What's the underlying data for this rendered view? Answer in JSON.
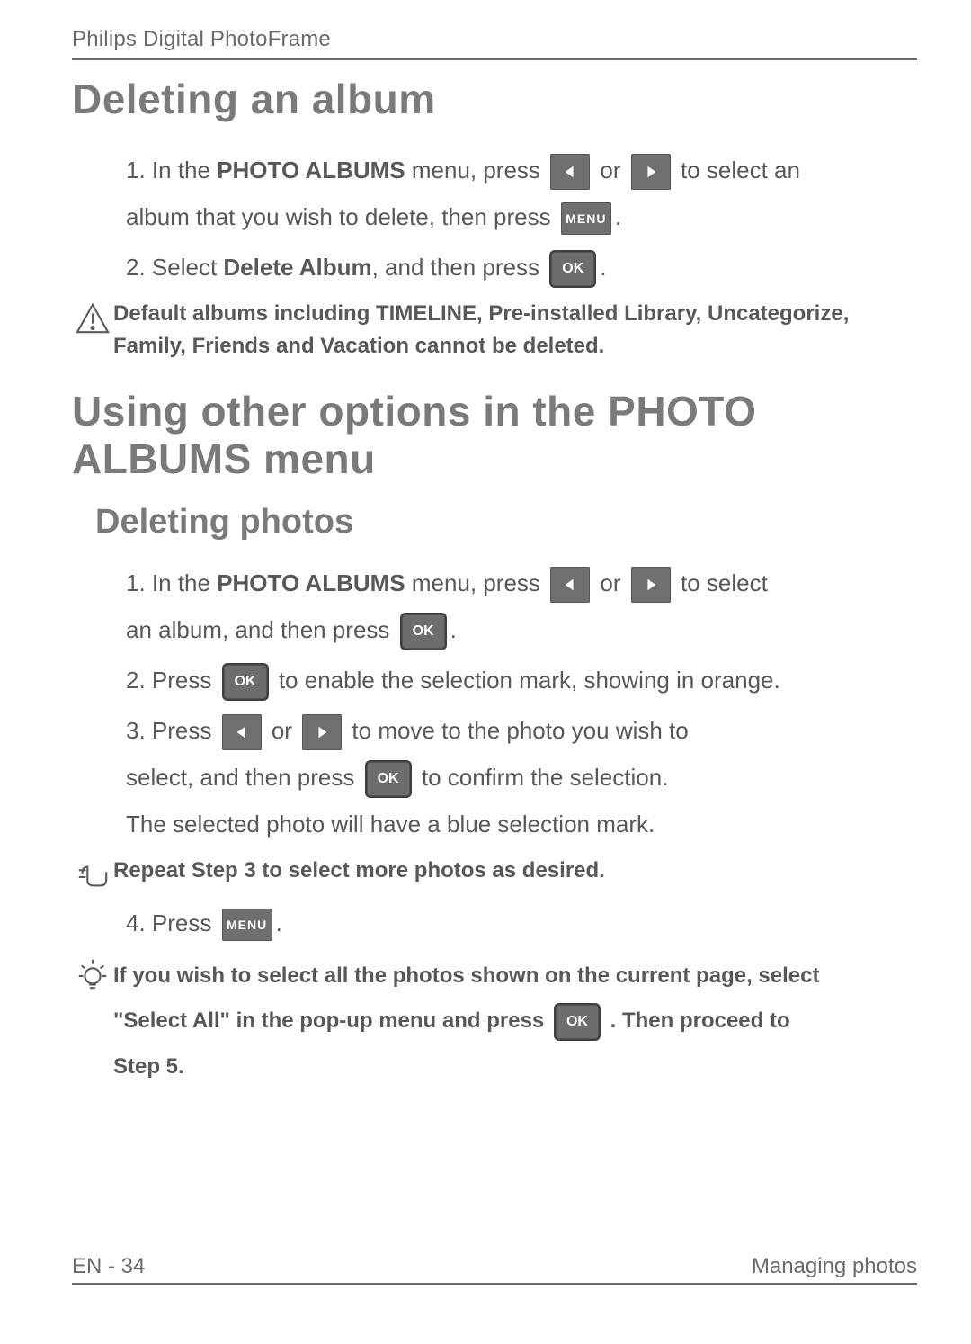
{
  "header": "Philips Digital PhotoFrame",
  "h1": "Deleting an album",
  "s1a": {
    "pre": "1.  In the ",
    "bold": "PHOTO ALBUMS",
    "post": " menu, press ",
    "or": " or ",
    "tail1": " to select an",
    "tail2": "album that you wish to delete, then press ",
    "period": "."
  },
  "s1b": {
    "pre": "2.  Select ",
    "bold": "Delete Album",
    "post": ", and then press ",
    "period": "."
  },
  "warn": "Default albums including TIMELINE, Pre-installed Library, Uncategorize, Family, Friends and Vacation cannot be deleted.",
  "h2": "Using other options in the PHOTO ALBUMS menu",
  "h3": "Deleting photos",
  "s2a": {
    "pre": "1.  In the ",
    "bold": "PHOTO ALBUMS",
    "post": " menu, press ",
    "or": " or ",
    "tail1": " to select",
    "tail2": "an album, and then press ",
    "period": "."
  },
  "s2b": {
    "pre": "2.  Press ",
    "post": " to enable the selection mark, showing in orange."
  },
  "s2c": {
    "pre": "3.  Press ",
    "or": " or ",
    "mid": " to move to the photo you wish to",
    "line2a": "select, and then press ",
    "line2b": " to confirm the selection.",
    "line3": "The selected photo will have a blue selection mark."
  },
  "repeat": "Repeat Step 3 to select more photos as desired.",
  "s2d": {
    "pre": "4.  Press ",
    "period": "."
  },
  "tip": {
    "l1": "If you wish to select all the photos shown on the current page, select",
    "l2a": "\"Select All\" in the pop-up menu and press ",
    "l2b": ". Then proceed to",
    "l3": "Step 5."
  },
  "footer": {
    "left": "EN - 34",
    "right": "Managing photos"
  },
  "btn": {
    "menu": "MENU",
    "ok": "OK"
  }
}
